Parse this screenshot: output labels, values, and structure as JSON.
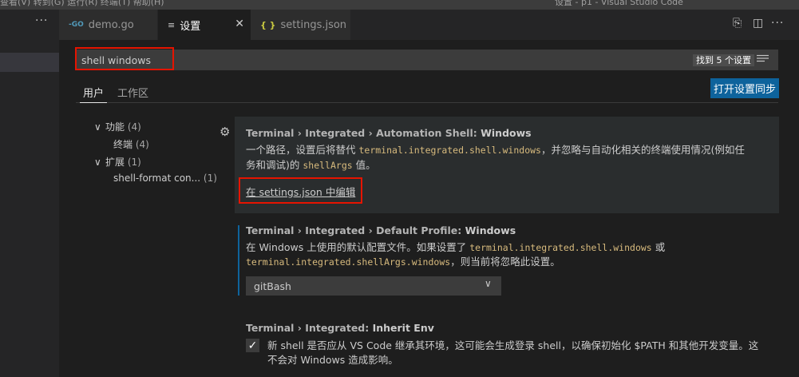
{
  "menubar": {
    "partial_left": "查看(V)  转到(G)  运行(R)  终端(T)  帮助(H)",
    "partial_title": "设置 - p1 - Visual Studio Code"
  },
  "sidebar": {
    "more": "···"
  },
  "tabs": [
    {
      "icon": "-GO",
      "label": "demo.go",
      "active": false
    },
    {
      "icon": "≡",
      "label": "设置",
      "active": true,
      "close": "✕"
    },
    {
      "icon": "{ }",
      "label": "settings.json",
      "active": false
    }
  ],
  "toolbar": {
    "open_json": "⎘",
    "split": "◫",
    "more": "···"
  },
  "search": {
    "value": "shell windows",
    "result_count": "找到 5 个设置"
  },
  "scopes": {
    "user": "用户",
    "workspace": "工作区"
  },
  "sync_button": "打开设置同步",
  "toc": {
    "features": {
      "label": "功能",
      "count": "(4)"
    },
    "terminal": {
      "label": "终端",
      "count": "(4)"
    },
    "extensions": {
      "label": "扩展",
      "count": "(1)"
    },
    "shell_format": {
      "label": "shell-format con...",
      "count": "(1)"
    }
  },
  "settings": [
    {
      "category": "Terminal › Integrated › Automation Shell: ",
      "name": "Windows",
      "desc1_a": "一个路径，设置后将替代 ",
      "desc1_code": "terminal.integrated.shell.windows",
      "desc1_b": "，并忽略与自动化相关的终端使用情况(例如任",
      "desc2_a": "务和调试)的 ",
      "desc2_code": "shellArgs",
      "desc2_b": " 值。",
      "link": "在 settings.json 中编辑"
    },
    {
      "category": "Terminal › Integrated › Default Profile: ",
      "name": "Windows",
      "desc1_a": "在 Windows 上使用的默认配置文件。如果设置了 ",
      "desc1_code": "terminal.integrated.shell.windows",
      "desc1_b": " 或",
      "desc2_code": "terminal.integrated.shellArgs.windows",
      "desc2_b": "，则当前将忽略此设置。",
      "value": "gitBash"
    },
    {
      "category": "Terminal › Integrated: ",
      "name": "Inherit Env",
      "checked": true,
      "desc1": "新 shell 是否应从 VS Code 继承其环境，这可能会生成登录 shell，以确保初始化 $PATH 和其他开发变量。这",
      "desc2": "不会对 Windows 造成影响。"
    }
  ],
  "colors": {
    "accent": "#0e639c",
    "highlight_box": "#e51400",
    "code": "#d7ba7d"
  }
}
